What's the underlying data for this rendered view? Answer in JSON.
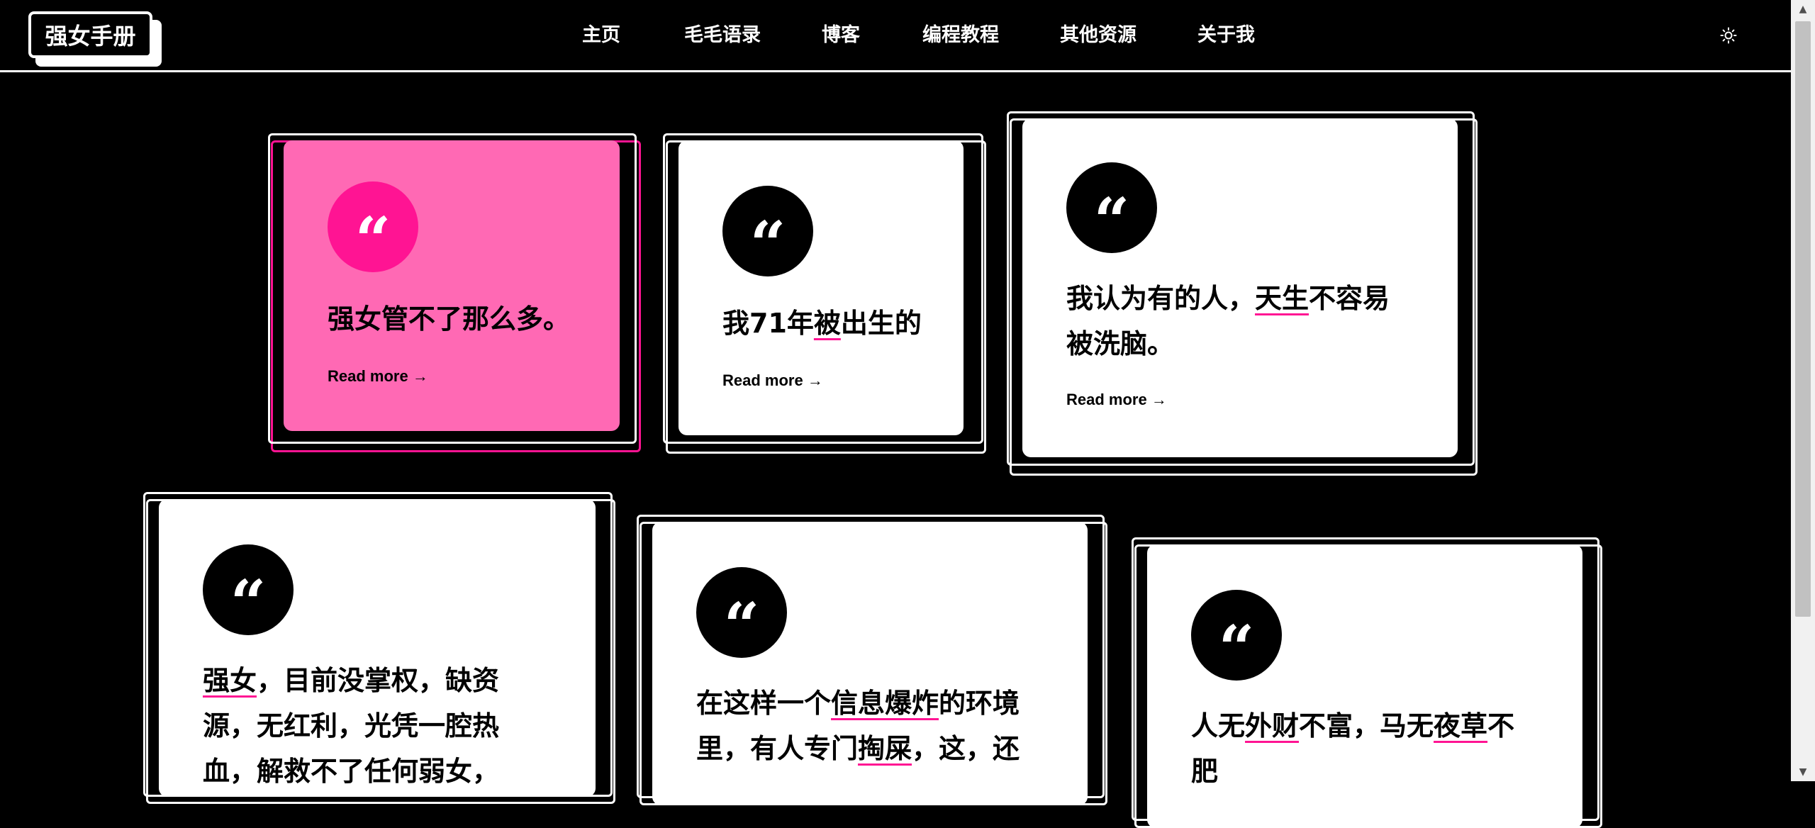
{
  "site": {
    "logo": "强女手册"
  },
  "nav": [
    {
      "label": "主页",
      "id": "home"
    },
    {
      "label": "毛毛语录",
      "id": "quotes"
    },
    {
      "label": "博客",
      "id": "blog"
    },
    {
      "label": "编程教程",
      "id": "tutorials"
    },
    {
      "label": "其他资源",
      "id": "resources"
    },
    {
      "label": "关于我",
      "id": "about"
    }
  ],
  "theme_toggle_icon": "sun-icon",
  "quote_glyph": "“",
  "read_more": "Read more →",
  "cards": [
    {
      "variant": "pink",
      "segments": [
        {
          "t": "强女管不了那么多。"
        }
      ]
    },
    {
      "variant": "white",
      "segments": [
        {
          "t": "我71年"
        },
        {
          "t": "被",
          "hl": true
        },
        {
          "t": "出生的"
        }
      ]
    },
    {
      "variant": "white",
      "segments": [
        {
          "t": "我认为有的人，"
        },
        {
          "t": "天生",
          "hl": true
        },
        {
          "t": "不容易被洗脑。"
        }
      ]
    },
    {
      "variant": "white",
      "segments": [
        {
          "t": "强女",
          "hl": true
        },
        {
          "t": "，目前没掌权，缺资源，无红利，光凭一腔热血，解救不了任何弱女，只"
        }
      ]
    },
    {
      "variant": "white",
      "segments": [
        {
          "t": "在这样一个"
        },
        {
          "t": "信息爆炸",
          "hl": true
        },
        {
          "t": "的环境里，有人专门"
        },
        {
          "t": "掏屎",
          "hl": true
        },
        {
          "t": "，这，还"
        }
      ]
    },
    {
      "variant": "white",
      "segments": [
        {
          "t": "人无"
        },
        {
          "t": "外财",
          "hl": true
        },
        {
          "t": "不富，马无"
        },
        {
          "t": "夜草",
          "hl": true
        },
        {
          "t": "不肥"
        }
      ]
    }
  ],
  "colors": {
    "background": "#000000",
    "accent": "#ff1493",
    "pink_card": "#ff69b4",
    "card": "#ffffff"
  }
}
